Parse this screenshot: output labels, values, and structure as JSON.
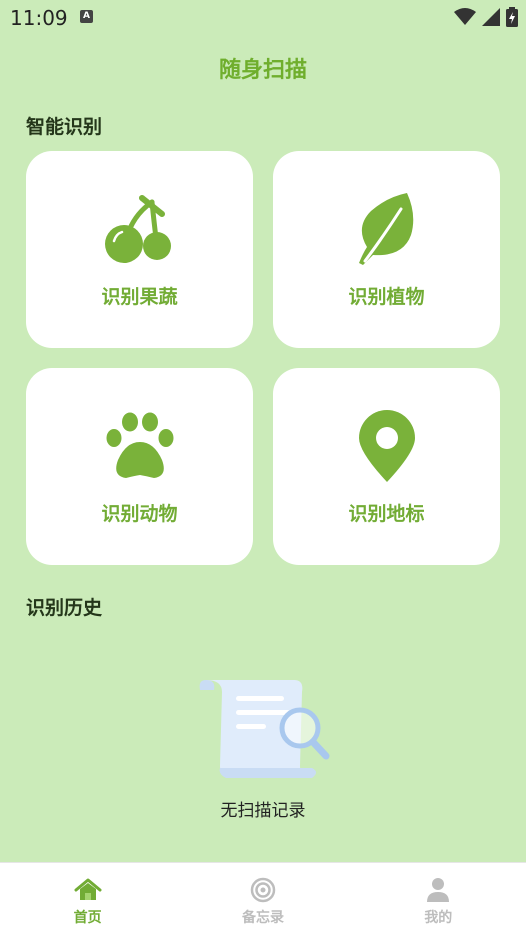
{
  "status_bar": {
    "time": "11:09",
    "notification_badge": "A"
  },
  "header": {
    "title": "随身扫描"
  },
  "smart": {
    "title": "智能识别",
    "cards": [
      {
        "label": "识别果蔬",
        "icon": "cherry-icon"
      },
      {
        "label": "识别植物",
        "icon": "leaf-icon"
      },
      {
        "label": "识别动物",
        "icon": "paw-icon"
      },
      {
        "label": "识别地标",
        "icon": "location-pin-icon"
      }
    ]
  },
  "history": {
    "title": "识别历史",
    "empty_text": "无扫描记录",
    "empty_icon": "document-search-icon"
  },
  "nav": {
    "items": [
      {
        "label": "首页",
        "icon": "home-icon",
        "active": true
      },
      {
        "label": "备忘录",
        "icon": "target-icon",
        "active": false
      },
      {
        "label": "我的",
        "icon": "person-icon",
        "active": false
      }
    ]
  },
  "colors": {
    "background": "#cbebb9",
    "accent": "#72ac35",
    "icon_green": "#7ab23a",
    "inactive": "#bdbdbd",
    "card": "#ffffff"
  }
}
